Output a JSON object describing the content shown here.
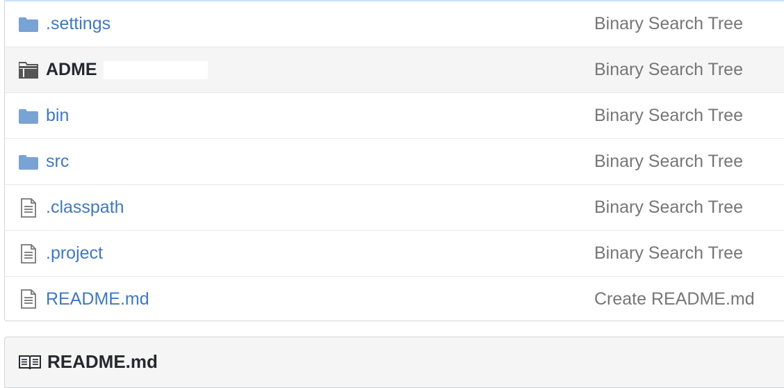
{
  "files": [
    {
      "name": ".settings",
      "type": "folder",
      "message": "Binary Search Tree"
    },
    {
      "name": "ADME",
      "type": "submodule",
      "message": "Binary Search Tree"
    },
    {
      "name": "bin",
      "type": "folder",
      "message": "Binary Search Tree"
    },
    {
      "name": "src",
      "type": "folder",
      "message": "Binary Search Tree"
    },
    {
      "name": ".classpath",
      "type": "file",
      "message": "Binary Search Tree"
    },
    {
      "name": ".project",
      "type": "file",
      "message": "Binary Search Tree"
    },
    {
      "name": "README.md",
      "type": "file",
      "message": "Create README.md"
    }
  ],
  "readme": {
    "title": "README.md",
    "icon": "book-icon"
  },
  "colors": {
    "link": "#4078c0",
    "folder": "#79a2d5",
    "message": "#767676",
    "row_highlight": "#f5f5f5"
  }
}
